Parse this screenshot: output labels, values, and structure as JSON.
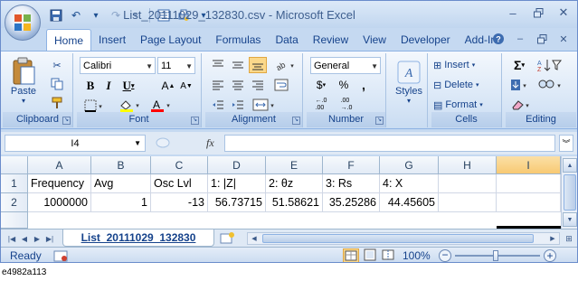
{
  "window": {
    "title": "List_20111029_132830.csv - Microsoft Excel"
  },
  "ribbon_tabs": [
    "Home",
    "Insert",
    "Page Layout",
    "Formulas",
    "Data",
    "Review",
    "View",
    "Developer",
    "Add-Ins"
  ],
  "ribbon": {
    "clipboard": {
      "label": "Clipboard",
      "paste_label": "Paste"
    },
    "font": {
      "label": "Font",
      "font_name": "Calibri",
      "font_size": "11"
    },
    "alignment": {
      "label": "Alignment"
    },
    "number": {
      "label": "Number",
      "format": "General",
      "dollar": "$",
      "percent": "%",
      "comma": ",",
      "inc_decimal": "←.0\n.00",
      "dec_decimal": ".00\n→.0"
    },
    "styles": {
      "label": "Styles"
    },
    "cells": {
      "label": "Cells",
      "insert": "Insert",
      "delete": "Delete",
      "format": "Format"
    },
    "editing": {
      "label": "Editing"
    }
  },
  "formula_bar": {
    "name_box": "I4",
    "fx": "fx",
    "formula": ""
  },
  "sheet": {
    "columns": [
      "A",
      "B",
      "C",
      "D",
      "E",
      "F",
      "G",
      "H",
      "I"
    ],
    "selected_column": "I",
    "rows": [
      {
        "num": "1",
        "cells": [
          "Frequency",
          "Avg",
          "Osc Lvl",
          "1: |Z|",
          "2: θz",
          "3: Rs",
          "4: X",
          "",
          ""
        ]
      },
      {
        "num": "2",
        "cells": [
          "1000000",
          "1",
          "-13",
          "56.73715",
          "51.58621",
          "35.25286",
          "44.45605",
          "",
          ""
        ]
      }
    ]
  },
  "sheet_tabs": {
    "active": "List_20111029_132830"
  },
  "status_bar": {
    "status": "Ready",
    "zoom": "100%"
  },
  "caption": "e4982a113"
}
